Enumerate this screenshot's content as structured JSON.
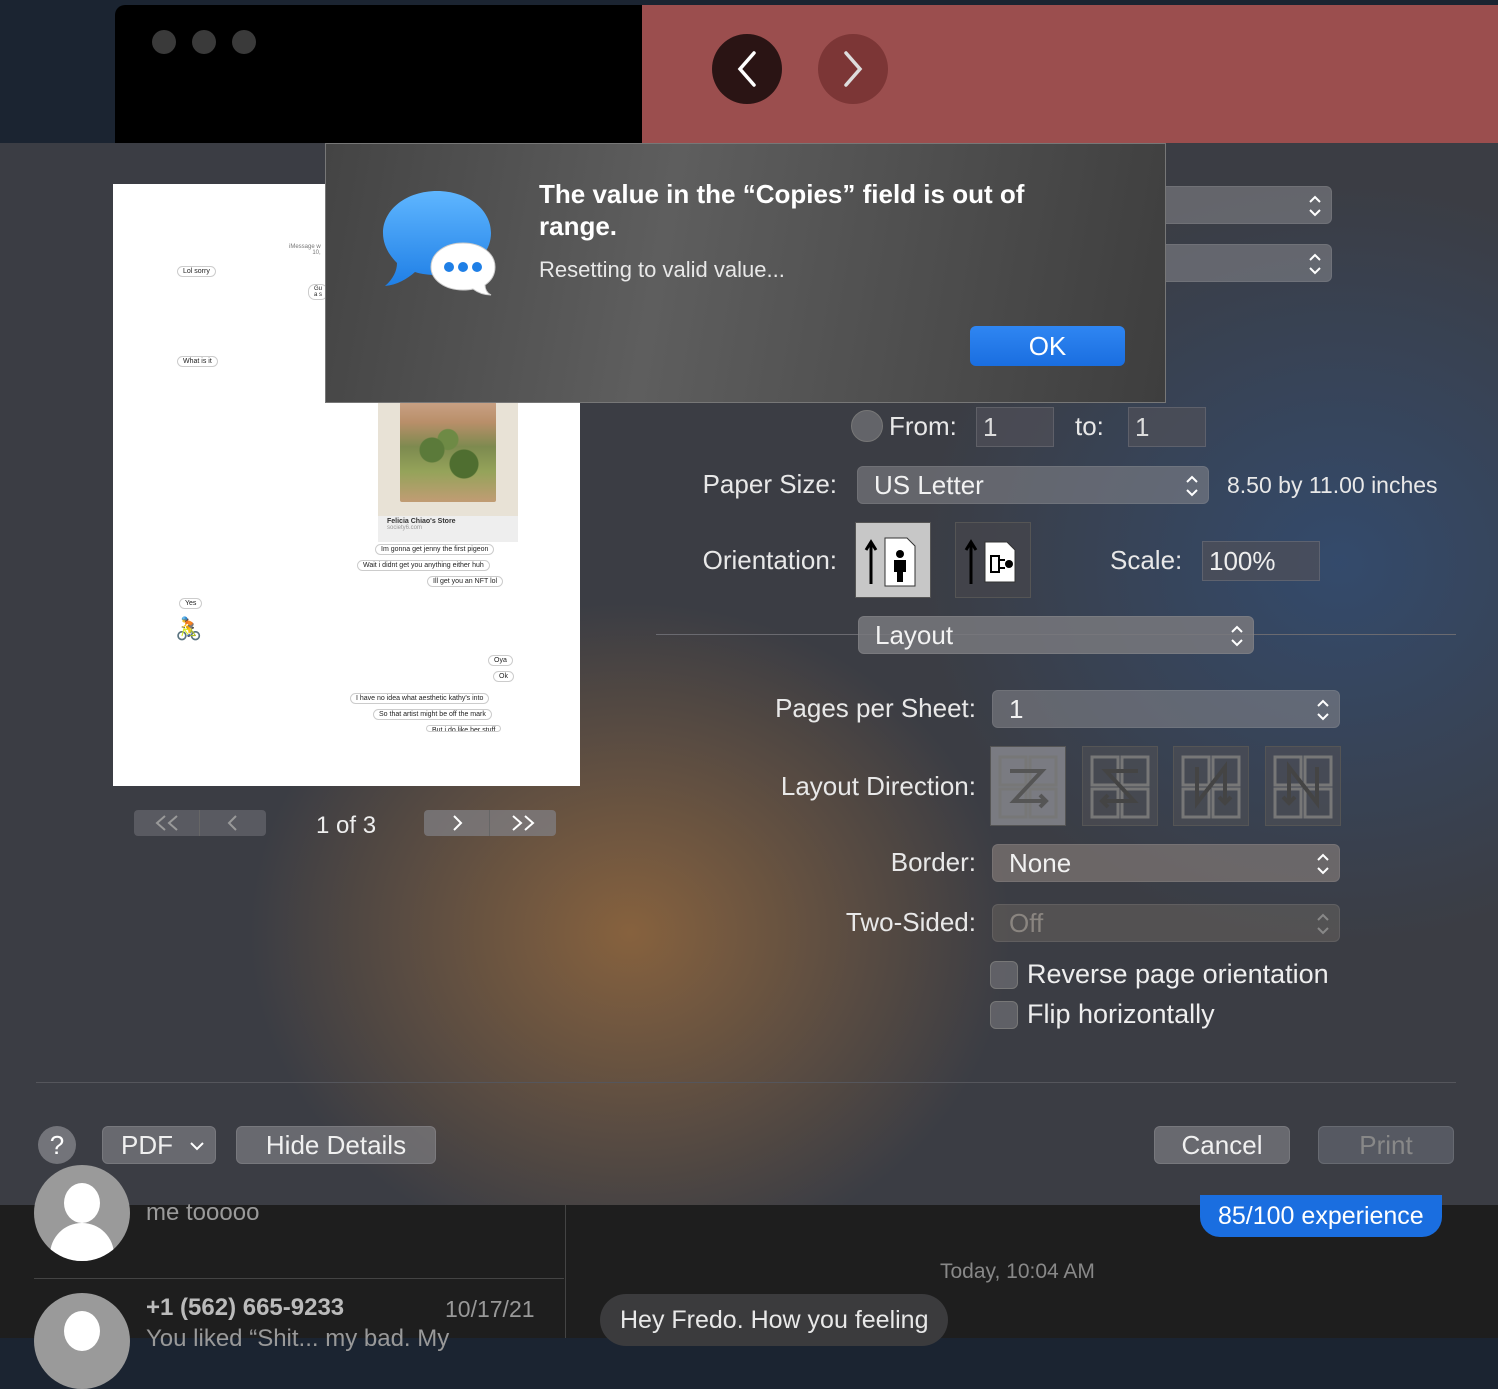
{
  "background": {
    "back_label": "<",
    "forward_label": ">"
  },
  "preview": {
    "header": "iMessage w\n10,",
    "bubbles": [
      "Lol sorry",
      "Gu\na s",
      "What is it",
      "Felicia Chiao's Store",
      "society6.com",
      "Im gonna get jenny the first pigeon",
      "Wait i didnt get you anything either huh",
      "Ill get you an NFT lol",
      "Yes",
      "Oya",
      "Ok",
      "I have no idea what aesthetic kathy's into",
      "So that artist might be off the mark",
      "But i do like her stuff"
    ],
    "page_indicator": "1 of 3"
  },
  "form": {
    "from_label": "From:",
    "from_value": "1",
    "to_label": "to:",
    "to_value": "1",
    "paper_size_label": "Paper Size:",
    "paper_size_value": "US Letter",
    "paper_size_dims": "8.50 by 11.00 inches",
    "orientation_label": "Orientation:",
    "scale_label": "Scale:",
    "scale_value": "100%",
    "section_value": "Layout",
    "pages_per_sheet_label": "Pages per Sheet:",
    "pages_per_sheet_value": "1",
    "layout_direction_label": "Layout Direction:",
    "border_label": "Border:",
    "border_value": "None",
    "two_sided_label": "Two-Sided:",
    "two_sided_value": "Off",
    "reverse_label": "Reverse page orientation",
    "flip_label": "Flip horizontally"
  },
  "footer": {
    "help": "?",
    "pdf": "PDF",
    "hide_details": "Hide Details",
    "cancel": "Cancel",
    "print": "Print"
  },
  "alert": {
    "title": "The value in the “Copies” field is out of range.",
    "message": "Resetting to valid value...",
    "ok": "OK"
  },
  "messages": {
    "item1_preview": "me tooooo",
    "item2_name": "+1 (562) 665-9233",
    "item2_date": "10/17/21",
    "item2_preview": "You liked “Shit... my bad. My",
    "sent_bubble": "85/100 experience",
    "timestamp": "Today, 10:04 AM",
    "received_bubble": "Hey Fredo. How you feeling"
  },
  "colors": {
    "accent": "#1a6ee0",
    "sent_bubble": "#1a6ee0",
    "alert_icon": "#3a9df5"
  }
}
